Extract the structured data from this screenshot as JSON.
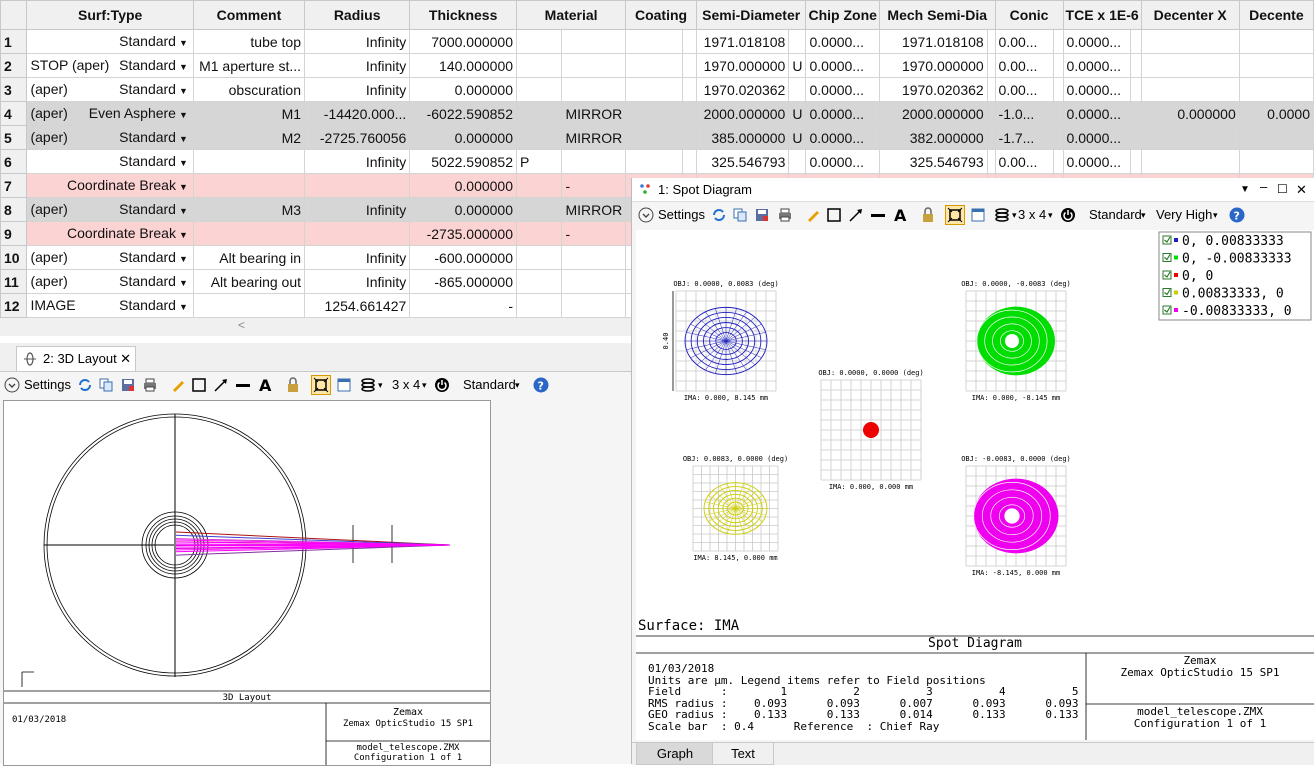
{
  "lde": {
    "headers": [
      "Surf:Type",
      "Comment",
      "Radius",
      "Thickness",
      "Material",
      "Coating",
      "Semi-Diameter",
      "Chip Zone",
      "Mech Semi-Dia",
      "Conic",
      "TCE x 1E-6",
      "Decenter X",
      "Decente"
    ],
    "rows": [
      {
        "num": "1",
        "label": "",
        "type": "Standard",
        "comment": "tube top",
        "radius": "Infinity",
        "thickness": "7000.000000",
        "tsolve": "",
        "material": "",
        "coating": "",
        "semi": "1971.018108",
        "semi_solve": "",
        "chip": "0.0000...",
        "mech": "1971.018108",
        "conic": "0.00...",
        "tce": "0.0000...",
        "decx": "",
        "decy": ""
      },
      {
        "num": "2",
        "label": "STOP (aper)",
        "type": "Standard",
        "comment": "M1 aperture st...",
        "radius": "Infinity",
        "thickness": "140.000000",
        "tsolve": "",
        "material": "",
        "coating": "",
        "semi": "1970.000000",
        "semi_solve": "U",
        "chip": "0.0000...",
        "mech": "1970.000000",
        "conic": "0.00...",
        "tce": "0.0000...",
        "decx": "",
        "decy": ""
      },
      {
        "num": "3",
        "label": "(aper)",
        "type": "Standard",
        "comment": "obscuration",
        "radius": "Infinity",
        "thickness": "0.000000",
        "tsolve": "",
        "material": "",
        "coating": "",
        "semi": "1970.020362",
        "semi_solve": "",
        "chip": "0.0000...",
        "mech": "1970.020362",
        "conic": "0.00...",
        "tce": "0.0000...",
        "decx": "",
        "decy": ""
      },
      {
        "num": "4",
        "label": "(aper)",
        "type": "Even Asphere",
        "comment": "M1",
        "radius": "-14420.000...",
        "thickness": "-6022.590852",
        "tsolve": "",
        "material": "MIRROR",
        "coating": "",
        "semi": "2000.000000",
        "semi_solve": "U",
        "chip": "0.0000...",
        "mech": "2000.000000",
        "conic": "-1.0...",
        "tce": "0.0000...",
        "decx": "0.000000",
        "decy": "0.0000"
      },
      {
        "num": "5",
        "label": "(aper)",
        "type": "Standard",
        "comment": "M2",
        "radius": "-2725.760056",
        "thickness": "0.000000",
        "tsolve": "",
        "material": "MIRROR",
        "coating": "",
        "semi": "385.000000",
        "semi_solve": "U",
        "chip": "0.0000...",
        "mech": "382.000000",
        "conic": "-1.7...",
        "tce": "0.0000...",
        "decx": "",
        "decy": ""
      },
      {
        "num": "6",
        "label": "",
        "type": "Standard",
        "comment": "",
        "radius": "Infinity",
        "thickness": "5022.590852",
        "tsolve": "P",
        "material": "",
        "coating": "",
        "semi": "325.546793",
        "semi_solve": "",
        "chip": "0.0000...",
        "mech": "325.546793",
        "conic": "0.00...",
        "tce": "0.0000...",
        "decx": "",
        "decy": ""
      },
      {
        "num": "7",
        "label": "",
        "type": "Coordinate Break",
        "comment": "",
        "radius": "",
        "thickness": "0.000000",
        "tsolve": "",
        "material": "-",
        "coating": "",
        "semi": "",
        "semi_solve": "",
        "chip": "",
        "mech": "",
        "conic": "",
        "tce": "",
        "decx": "",
        "decy": ""
      },
      {
        "num": "8",
        "label": "(aper)",
        "type": "Standard",
        "comment": "M3",
        "radius": "Infinity",
        "thickness": "0.000000",
        "tsolve": "",
        "material": "MIRROR",
        "coating": "",
        "semi": "",
        "semi_solve": "",
        "chip": "",
        "mech": "",
        "conic": "",
        "tce": "",
        "decx": "",
        "decy": ""
      },
      {
        "num": "9",
        "label": "",
        "type": "Coordinate Break",
        "comment": "",
        "radius": "",
        "thickness": "-2735.000000",
        "tsolve": "",
        "material": "-",
        "coating": "",
        "semi": "",
        "semi_solve": "",
        "chip": "",
        "mech": "",
        "conic": "",
        "tce": "",
        "decx": "",
        "decy": ""
      },
      {
        "num": "10",
        "label": "(aper)",
        "type": "Standard",
        "comment": "Alt bearing in",
        "radius": "Infinity",
        "thickness": "-600.000000",
        "tsolve": "",
        "material": "",
        "coating": "",
        "semi": "",
        "semi_solve": "",
        "chip": "",
        "mech": "",
        "conic": "",
        "tce": "",
        "decx": "",
        "decy": ""
      },
      {
        "num": "11",
        "label": "(aper)",
        "type": "Standard",
        "comment": "Alt bearing out",
        "radius": "Infinity",
        "thickness": "-865.000000",
        "tsolve": "",
        "material": "",
        "coating": "",
        "semi": "",
        "semi_solve": "",
        "chip": "",
        "mech": "",
        "conic": "",
        "tce": "",
        "decx": "",
        "decy": ""
      },
      {
        "num": "12",
        "label": "IMAGE",
        "type": "Standard",
        "comment": "",
        "radius": "1254.661427",
        "thickness": "-",
        "tsolve": "",
        "material": "",
        "coating": "",
        "semi": "",
        "semi_solve": "",
        "chip": "",
        "mech": "",
        "conic": "",
        "tce": "",
        "decx": "",
        "decy": ""
      }
    ],
    "row_styles": [
      "white",
      "white",
      "white",
      "gray",
      "gray",
      "white",
      "pink",
      "gray",
      "pink",
      "white",
      "white",
      "white"
    ]
  },
  "layout_window": {
    "tab_label": "2: 3D Layout",
    "close_glyph": "✕",
    "toolbar": {
      "settings": "Settings",
      "grid": "3 x 4",
      "mode": "Standard"
    },
    "title_block": {
      "caption": "3D Layout",
      "date": "01/03/2018",
      "vendor": "Zemax",
      "product": "Zemax OpticStudio 15 SP1",
      "file": "model_telescope.ZMX",
      "config": "Configuration 1 of 1"
    }
  },
  "spot_window": {
    "title": "1: Spot Diagram",
    "toolbar": {
      "settings": "Settings",
      "grid": "3 x 4",
      "mode": "Standard",
      "quality": "Very High"
    },
    "legend": [
      {
        "label": "0, 0.00833333",
        "color": "#2020c0"
      },
      {
        "label": "0, -0.00833333",
        "color": "#00dd00"
      },
      {
        "label": "0, 0",
        "color": "#ee0000"
      },
      {
        "label": "0.00833333, 0",
        "color": "#cccc00"
      },
      {
        "label": "-0.00833333, 0",
        "color": "#ee00ee"
      }
    ],
    "plots": [
      {
        "obj": "OBJ: 0.0000, 0.0083 (deg)",
        "ima": "IMA: 0.000, 8.145 mm",
        "color": "#2020c0"
      },
      {
        "obj": "OBJ: 0.0000, -0.0083 (deg)",
        "ima": "IMA: 0.000, -8.145 mm",
        "color": "#00dd00"
      },
      {
        "obj": "OBJ: 0.0000, 0.0000 (deg)",
        "ima": "IMA: 0.000, 0.000 mm",
        "color": "#ee0000"
      },
      {
        "obj": "OBJ: 0.0083, 0.0000 (deg)",
        "ima": "IMA: 8.145, 0.000 mm",
        "color": "#cccc00"
      },
      {
        "obj": "OBJ: -0.0083, 0.0000 (deg)",
        "ima": "IMA: -8.145, 0.000 mm",
        "color": "#ee00ee"
      }
    ],
    "scale_label": "0.40",
    "surface": "Surface: IMA",
    "heading": "Spot Diagram",
    "date": "01/03/2018",
    "note": "Units are µm. Legend items refer to Field positions",
    "field_row": "Field      :        1          2          3          4          5",
    "rms_row": "RMS radius :    0.093      0.093      0.007      0.093      0.093",
    "geo_row": "GEO radius :    0.133      0.133      0.014      0.133      0.133",
    "scale_row": "Scale bar  : 0.4      Reference  : Chief Ray",
    "vendor": "Zemax",
    "product": "Zemax OpticStudio 15 SP1",
    "file": "model_telescope.ZMX",
    "config": "Configuration 1 of 1",
    "tabs": [
      "Graph",
      "Text"
    ]
  }
}
